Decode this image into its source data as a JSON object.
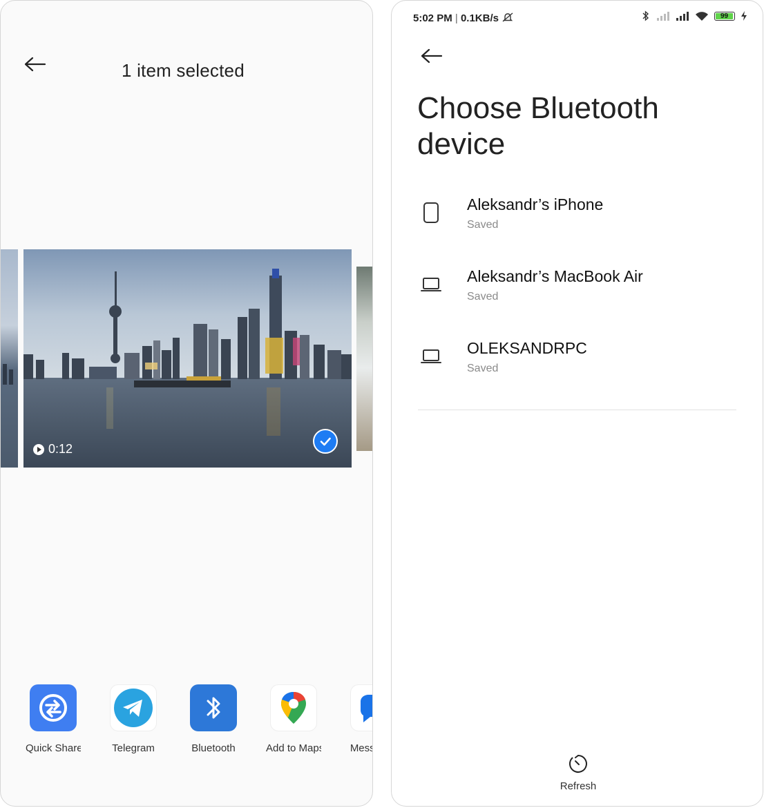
{
  "share_screen": {
    "title": "1 item selected",
    "video": {
      "duration": "0:12"
    },
    "apps": [
      {
        "label": "Quick Share",
        "icon": "quick-share-icon",
        "color": "#3f7ef1"
      },
      {
        "label": "Telegram",
        "icon": "telegram-icon",
        "color": "#2aa3e0"
      },
      {
        "label": "Bluetooth",
        "icon": "bluetooth-icon",
        "color": "#2d78d8"
      },
      {
        "label": "Add to Maps",
        "icon": "google-maps-icon",
        "color": "#ffffff"
      },
      {
        "label": "Messages",
        "icon": "messages-icon",
        "color": "#ffffff"
      }
    ],
    "accent_color": "#1e7cf3"
  },
  "bluetooth_screen": {
    "status_bar": {
      "time": "5:02 PM",
      "speed": "0.1KB/s",
      "battery": "99"
    },
    "title": "Choose Bluetooth device",
    "devices": [
      {
        "name": "Aleksandr’s iPhone",
        "status": "Saved",
        "icon": "phone-icon"
      },
      {
        "name": "Aleksandr’s MacBook Air",
        "status": "Saved",
        "icon": "laptop-icon"
      },
      {
        "name": "OLEKSANDRPC",
        "status": "Saved",
        "icon": "laptop-icon"
      }
    ],
    "refresh_label": "Refresh"
  }
}
